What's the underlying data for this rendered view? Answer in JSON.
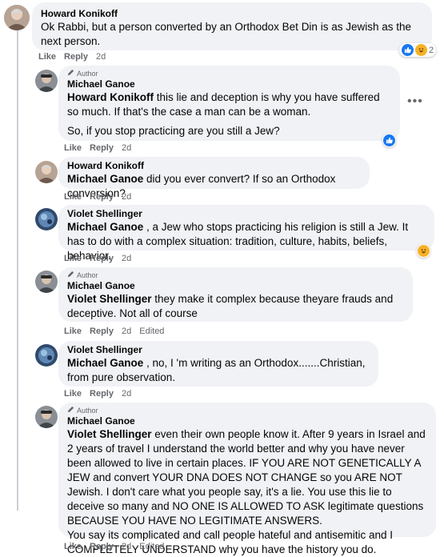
{
  "comments": [
    {
      "author": "Howard Konikoff",
      "text": "Ok Rabbi, but a person converted by an Orthodox Bet Din is as Jewish as the next person.",
      "actions": [
        "Like",
        "Reply"
      ],
      "time": "2d",
      "reaction_count": "2"
    },
    {
      "author_badge": "Author",
      "author": "Michael Ganoe",
      "tag": "Howard Konikoff",
      "text_a": " this lie and deception is why you have suffered so much. If that's the case a man can be a woman.",
      "text_b": "So, if you stop practicing are you still a Jew?",
      "actions": [
        "Like",
        "Reply"
      ],
      "time": "2d",
      "more_icon": "more-horizontal-icon"
    },
    {
      "author": "Howard Konikoff",
      "tag": "Michael Ganoe",
      "text": " did you ever convert? If so an Orthodox conversion?",
      "actions": [
        "Like",
        "Reply"
      ],
      "time": "2d"
    },
    {
      "author": "Violet Shellinger",
      "tag": "Michael Ganoe",
      "text": " , a Jew who stops practicing his religion is still a Jew. It has to do with a complex situation: tradition, culture, habits, beliefs, behavior.",
      "actions": [
        "Like",
        "Reply"
      ],
      "time": "2d"
    },
    {
      "author_badge": "Author",
      "author": "Michael Ganoe",
      "tag": "Violet Shellinger",
      "text": " they make it complex because theyare frauds and deceptive. Not all of course",
      "actions": [
        "Like",
        "Reply"
      ],
      "time": "2d",
      "edited": "Edited"
    },
    {
      "author": "Violet Shellinger",
      "tag": "Michael Ganoe",
      "text": " , no, I 'm writing as an Orthodox.......Christian, from pure observation.",
      "actions": [
        "Like",
        "Reply"
      ],
      "time": "2d"
    },
    {
      "author_badge": "Author",
      "author": "Michael Ganoe",
      "tag": "Violet Shellinger",
      "text_a": " even their own people know it. After 9 years in Israel and 2 years of travel I understand the world better and why you have never been allowed to live in certain places. IF YOU ARE NOT GENETICALLY A JEW and convert YOUR DNA DOES NOT CHANGE so you ARE NOT Jewish. I don't care what you people say, it's a lie. You use this lie to deceive so many and NO ONE IS ALLOWED TO ASK legitimate questions BECAUSE YOU HAVE NO LEGITIMATE ANSWERS.",
      "text_b": "You say its complicated and call people hateful and antisemitic and I COMPLETELY UNDERSTAND why you have the history you do.",
      "actions": [
        "Like",
        "Reply"
      ],
      "time": "2d",
      "edited": "Edited"
    }
  ],
  "colors": {
    "bubble": "#f0f2f5",
    "meta": "#65676b",
    "like_blue": "#1877f2",
    "haha_yellow": "#f7b125"
  }
}
